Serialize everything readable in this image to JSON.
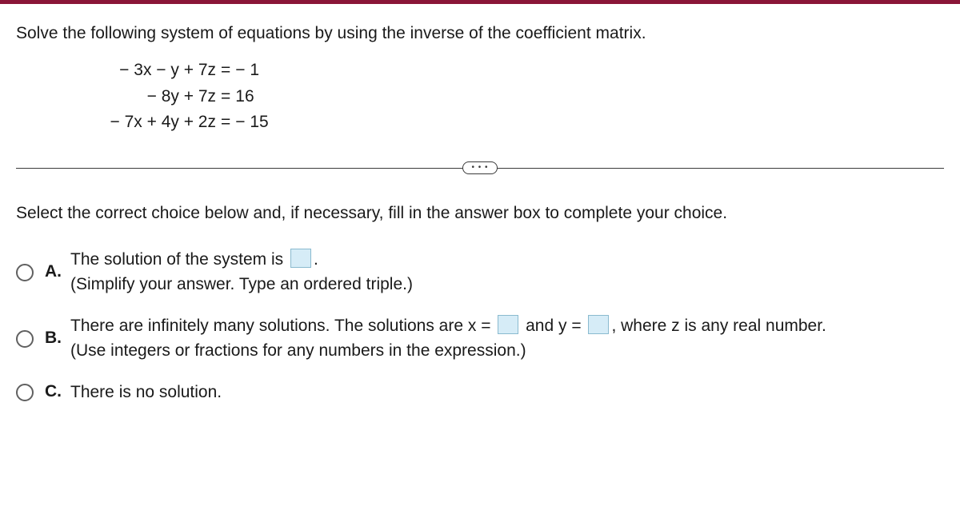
{
  "question": "Solve the following system of equations by using the inverse of the coefficient matrix.",
  "equations": [
    {
      "left": "− 3x − y + 7z",
      "right": "− 1"
    },
    {
      "left": "− 8y + 7z",
      "right": "16"
    },
    {
      "left": "− 7x + 4y + 2z",
      "right": "− 15"
    }
  ],
  "eq_sign": "=",
  "divider_dots": "• • •",
  "instruction": "Select the correct choice below and, if necessary, fill in the answer box to complete your choice.",
  "options": {
    "a": {
      "label": "A.",
      "line1_pre": "The solution of the system is ",
      "line1_post": ".",
      "hint": "(Simplify your answer. Type an ordered triple.)"
    },
    "b": {
      "label": "B.",
      "line1_pre": "There are infinitely many solutions. The solutions are x = ",
      "line1_mid": " and y = ",
      "line1_post": ", where z is any real number.",
      "hint": "(Use integers or fractions for any numbers in the expression.)"
    },
    "c": {
      "label": "C.",
      "text": "There is no solution."
    }
  }
}
